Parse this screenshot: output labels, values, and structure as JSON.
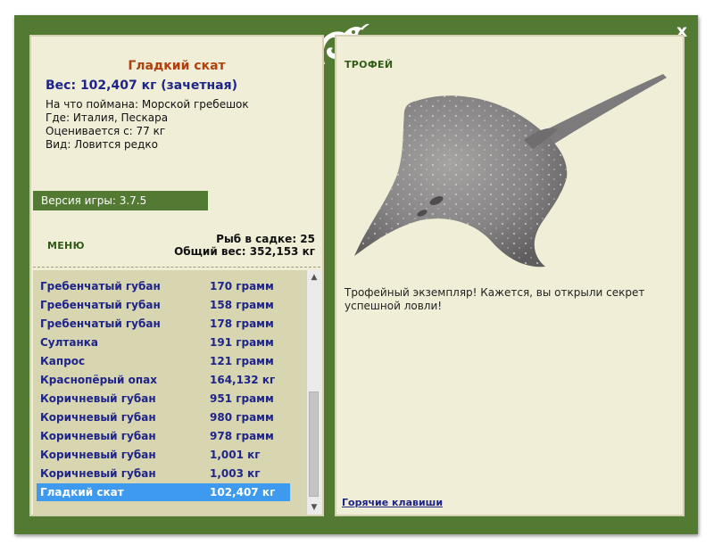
{
  "close_label": "x",
  "fish": {
    "title": "Гладкий скат",
    "weight_line": "Вес: 102,407 кг (зачетная)",
    "details": [
      "На что поймана: Морской гребешок",
      "Где: Италия, Пескара",
      "Оценивается с: 77 кг",
      "Вид: Ловится редко"
    ]
  },
  "version_label": "Версия игры: 3.7.5",
  "menu_label": "МЕНЮ",
  "cage": {
    "count_label": "Рыб в садке: 25",
    "total_label": "Общий вес: 352,153 кг"
  },
  "catch_list": [
    {
      "name": "Гребенчатый губан",
      "weight": "170 грамм"
    },
    {
      "name": "Гребенчатый губан",
      "weight": "158 грамм"
    },
    {
      "name": "Гребенчатый губан",
      "weight": "178 грамм"
    },
    {
      "name": "Султанка",
      "weight": "191 грамм"
    },
    {
      "name": "Капрос",
      "weight": "121 грамм"
    },
    {
      "name": "Краснопёрый опах",
      "weight": "164,132 кг"
    },
    {
      "name": "Коричневый губан",
      "weight": "951 грамм"
    },
    {
      "name": "Коричневый губан",
      "weight": "980 грамм"
    },
    {
      "name": "Коричневый губан",
      "weight": "978 грамм"
    },
    {
      "name": "Коричневый губан",
      "weight": "1,001 кг"
    },
    {
      "name": "Коричневый губан",
      "weight": "1,003 кг"
    },
    {
      "name": "Гладкий скат",
      "weight": "102,407 кг",
      "selected": true
    }
  ],
  "trophy": {
    "label": "ТРОФЕЙ",
    "description": "Трофейный экземпляр! Кажется, вы открыли секрет успешной ловли!"
  },
  "hotkeys_label": "Горячие клавиши",
  "colors": {
    "frame": "#537a33",
    "panel": "#f0eed7",
    "list_bg": "#d8d5b1",
    "selected": "#3d9aee",
    "fish_title": "#b0410f",
    "text_blue": "#1e2488"
  },
  "icons": {
    "logo": "chameleon-logo-icon",
    "close": "close-icon",
    "scroll_up": "scroll-up-icon",
    "scroll_down": "scroll-down-icon",
    "fish": "stingray-icon"
  }
}
